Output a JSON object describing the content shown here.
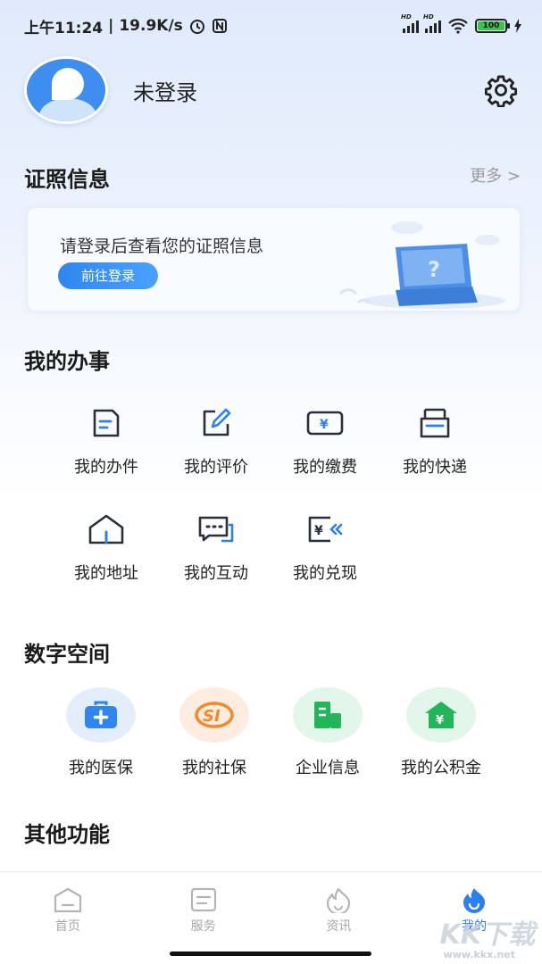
{
  "status_bar": {
    "time": "上午11:24",
    "speed": "19.9K/s",
    "battery": "100",
    "hd1": "HD",
    "hd2": "HD"
  },
  "profile": {
    "name": "未登录"
  },
  "license": {
    "title": "证照信息",
    "more": "更多 >",
    "tip": "请登录后查看您的证照信息",
    "login_button": "前往登录"
  },
  "affairs": {
    "title": "我的办事",
    "items": [
      {
        "label": "我的办件",
        "icon": "document-icon"
      },
      {
        "label": "我的评价",
        "icon": "edit-icon"
      },
      {
        "label": "我的缴费",
        "icon": "yuan-card-icon"
      },
      {
        "label": "我的快递",
        "icon": "parcel-icon"
      },
      {
        "label": "我的地址",
        "icon": "house-icon"
      },
      {
        "label": "我的互动",
        "icon": "chat-icon"
      },
      {
        "label": "我的兑现",
        "icon": "yuan-return-icon"
      }
    ]
  },
  "digital": {
    "title": "数字空间",
    "items": [
      {
        "label": "我的医保",
        "icon": "medical-kit-icon",
        "color": "#2f86f0"
      },
      {
        "label": "我的社保",
        "icon": "social-security-icon",
        "color": "#f08a2a"
      },
      {
        "label": "企业信息",
        "icon": "building-icon",
        "color": "#22b55a"
      },
      {
        "label": "我的公积金",
        "icon": "yuan-house-icon",
        "color": "#22b55a"
      }
    ]
  },
  "other": {
    "title": "其他功能"
  },
  "tabs": [
    {
      "label": "首页",
      "icon": "home-icon"
    },
    {
      "label": "服务",
      "icon": "service-icon"
    },
    {
      "label": "资讯",
      "icon": "flame-icon"
    },
    {
      "label": "我的",
      "icon": "mine-icon",
      "active": true
    }
  ],
  "watermark": {
    "main": "KK下载",
    "sub": "www.kkx.net"
  },
  "colors": {
    "accent": "#2d7ff0"
  }
}
